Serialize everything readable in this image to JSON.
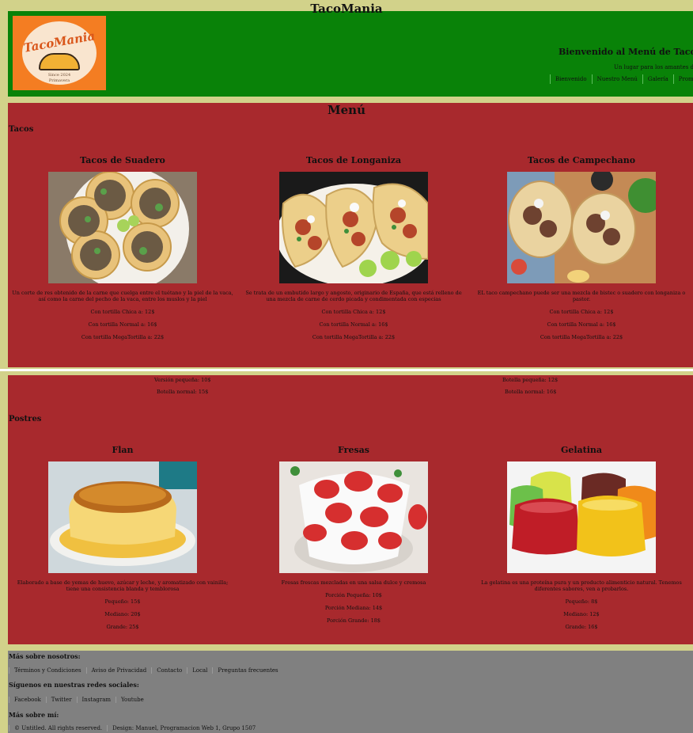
{
  "header": {
    "title": "TacoMania",
    "logo": {
      "brand": "TacoMania",
      "tagline_1": "Since 2024",
      "tagline_2": "Primavera"
    },
    "welcome": "Bienvenido al Menú de TacoMania",
    "tagline": "Un lugar para los amantes del T",
    "nav": [
      "Bienvenido",
      "Nuestro Menú",
      "Galería",
      "Promocio"
    ]
  },
  "menu": {
    "title": "Menú",
    "tacos_heading": "Tacos",
    "tacos": [
      {
        "name": "Tacos de Suadero",
        "desc": "Un corte de res obtenido de la carne que cuelga entre el tuétano y la piel de la vaca, así como la carne del pecho de la vaca, entre los muslos y la piel",
        "options": [
          "Con tortilla Chica a: 12$",
          "Con tortilla Normal a: 16$",
          "Con tortilla MegaTortilla a: 22$"
        ]
      },
      {
        "name": "Tacos de Longaniza",
        "desc": "Se trata de un embutido largo y angosto, originario de España, que está relleno de una mezcla de carne de cerdo picada y condimentada con especias",
        "options": [
          "Con tortilla Chica a: 12$",
          "Con tortilla Normal a: 16$",
          "Con tortilla MegaTortilla a: 22$"
        ]
      },
      {
        "name": "Tacos de Campechano",
        "desc": "EL taco campechano puede ser una mezcla de bistec o suadero con longaniza o pastor.",
        "options": [
          "Con tortilla Chica a: 12$",
          "Con tortilla Normal a: 16$",
          "Con tortilla MegaTortilla a: 22$"
        ]
      }
    ]
  },
  "drinks": {
    "left": [
      "Versión pequeña: 10$",
      "Botella normal: 15$"
    ],
    "right": [
      "Botella pequeña: 12$",
      "Botella normal: 16$"
    ]
  },
  "postres": {
    "heading": "Postres",
    "items": [
      {
        "name": "Flan",
        "desc": "Elaborado a base de yemas de huevo, azúcar y leche, y aromatizado con vainilla; tiene una consistencia blanda y temblorosa",
        "options": [
          "Pequeño: 15$",
          "Mediano: 20$",
          "Grande: 25$"
        ]
      },
      {
        "name": "Fresas",
        "desc": "Fresas frescas mezcladas en una salsa dulce y cremosa",
        "options": [
          "Porción Pequeña: 10$",
          "Porción Mediana: 14$",
          "Porción Grande: 18$"
        ]
      },
      {
        "name": "Gelatina",
        "desc": "La gelatina es una proteína pura y un producto alimenticio natural. Tenemos diferentes sabores, ven a probarlos.",
        "options": [
          "Pequeño: 8$",
          "Mediano: 12$",
          "Grande: 16$"
        ]
      }
    ]
  },
  "footer": {
    "about_heading": "Más sobre nosotros:",
    "about_links": [
      "Términos y Condiciones",
      "Aviso de Privacidad",
      "Contacto",
      "Local",
      "Preguntas frecuentes"
    ],
    "social_heading": "Síguenos en nuestras redes sociales:",
    "social_links": [
      "Facebook",
      "Twitter",
      "Instagram",
      "Youtube"
    ],
    "more_heading": "Más sobre mí:",
    "credits": [
      "© Untitled. All rights reserved.",
      "Design: Manuel, Programacion Web 1, Grupo 1507"
    ]
  },
  "colors": {
    "header_bg": "#098208",
    "section_bg": "#a8292d",
    "page_bg": "#d2d28a",
    "footer_bg": "#808080",
    "logo_bg": "#f47d22"
  }
}
